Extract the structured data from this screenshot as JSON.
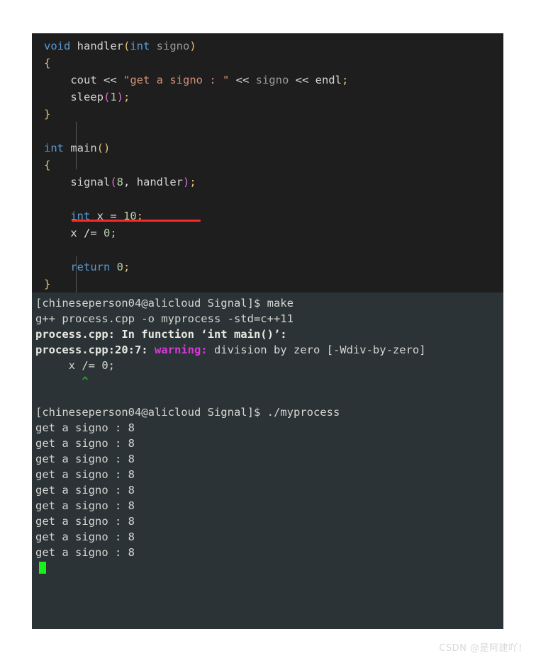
{
  "editor": {
    "background": "#1e1e1e",
    "annotation_color": "#fb2828",
    "lines": {
      "l1_void": "void",
      "l1_handler": " handler",
      "l1_open": "(",
      "l1_int": "int",
      "l1_signo": " signo",
      "l1_close": ")",
      "l2_brace": "{",
      "l3_cout": "    cout ",
      "l3_shift1": "<< ",
      "l3_string": "\"get a signo : \"",
      "l3_shift2": " << ",
      "l3_signo": "signo",
      "l3_shift3": " << ",
      "l3_endl": "endl",
      "l3_semi": ";",
      "l4_sleep": "    sleep",
      "l4_open": "(",
      "l4_one": "1",
      "l4_close": ")",
      "l4_semi": ";",
      "l5_brace": "}",
      "l7_int": "int",
      "l7_main": " main",
      "l7_parens": "()",
      "l8_brace": "{",
      "l9_signal": "    signal",
      "l9_open": "(",
      "l9_eight": "8",
      "l9_comma": ", ",
      "l9_handler": "handler",
      "l9_close": ")",
      "l9_semi": ";",
      "l11_int": "    int",
      "l11_xeq": " x = ",
      "l11_ten": "10",
      "l11_semi": ";",
      "l12_x": "    x ",
      "l12_op": "/= ",
      "l12_zero": "0",
      "l12_semi": ";",
      "l14_return": "    return",
      "l14_zero": " 0",
      "l14_semi": ";",
      "l15_brace": "}"
    }
  },
  "terminal": {
    "background": "#2b3337",
    "cursor_color": "#19f019",
    "prompt": "[chineseperson04@alicloud Signal]$ ",
    "lines": [
      {
        "type": "prompt",
        "prompt": "[chineseperson04@alicloud Signal]$ ",
        "command": "make"
      },
      {
        "type": "plain",
        "text": "g++ process.cpp -o myprocess -std=c++11"
      },
      {
        "type": "bold",
        "text": "process.cpp: In function ‘int main()’:"
      },
      {
        "type": "warning",
        "location": "process.cpp:20:7: ",
        "label": "warning:",
        "message": " division by zero [-Wdiv-by-zero]"
      },
      {
        "type": "plain",
        "text": "     x /= 0;"
      },
      {
        "type": "caret",
        "text": "       ^"
      },
      {
        "type": "blank",
        "text": " "
      },
      {
        "type": "prompt",
        "prompt": "[chineseperson04@alicloud Signal]$ ",
        "command": "./myprocess"
      },
      {
        "type": "plain",
        "text": "get a signo : 8"
      },
      {
        "type": "plain",
        "text": "get a signo : 8"
      },
      {
        "type": "plain",
        "text": "get a signo : 8"
      },
      {
        "type": "plain",
        "text": "get a signo : 8"
      },
      {
        "type": "plain",
        "text": "get a signo : 8"
      },
      {
        "type": "plain",
        "text": "get a signo : 8"
      },
      {
        "type": "plain",
        "text": "get a signo : 8"
      },
      {
        "type": "plain",
        "text": "get a signo : 8"
      },
      {
        "type": "plain",
        "text": "get a signo : 8"
      },
      {
        "type": "cursor",
        "text": ""
      }
    ]
  },
  "watermark": {
    "text": "CSDN @是阿建吖！"
  }
}
